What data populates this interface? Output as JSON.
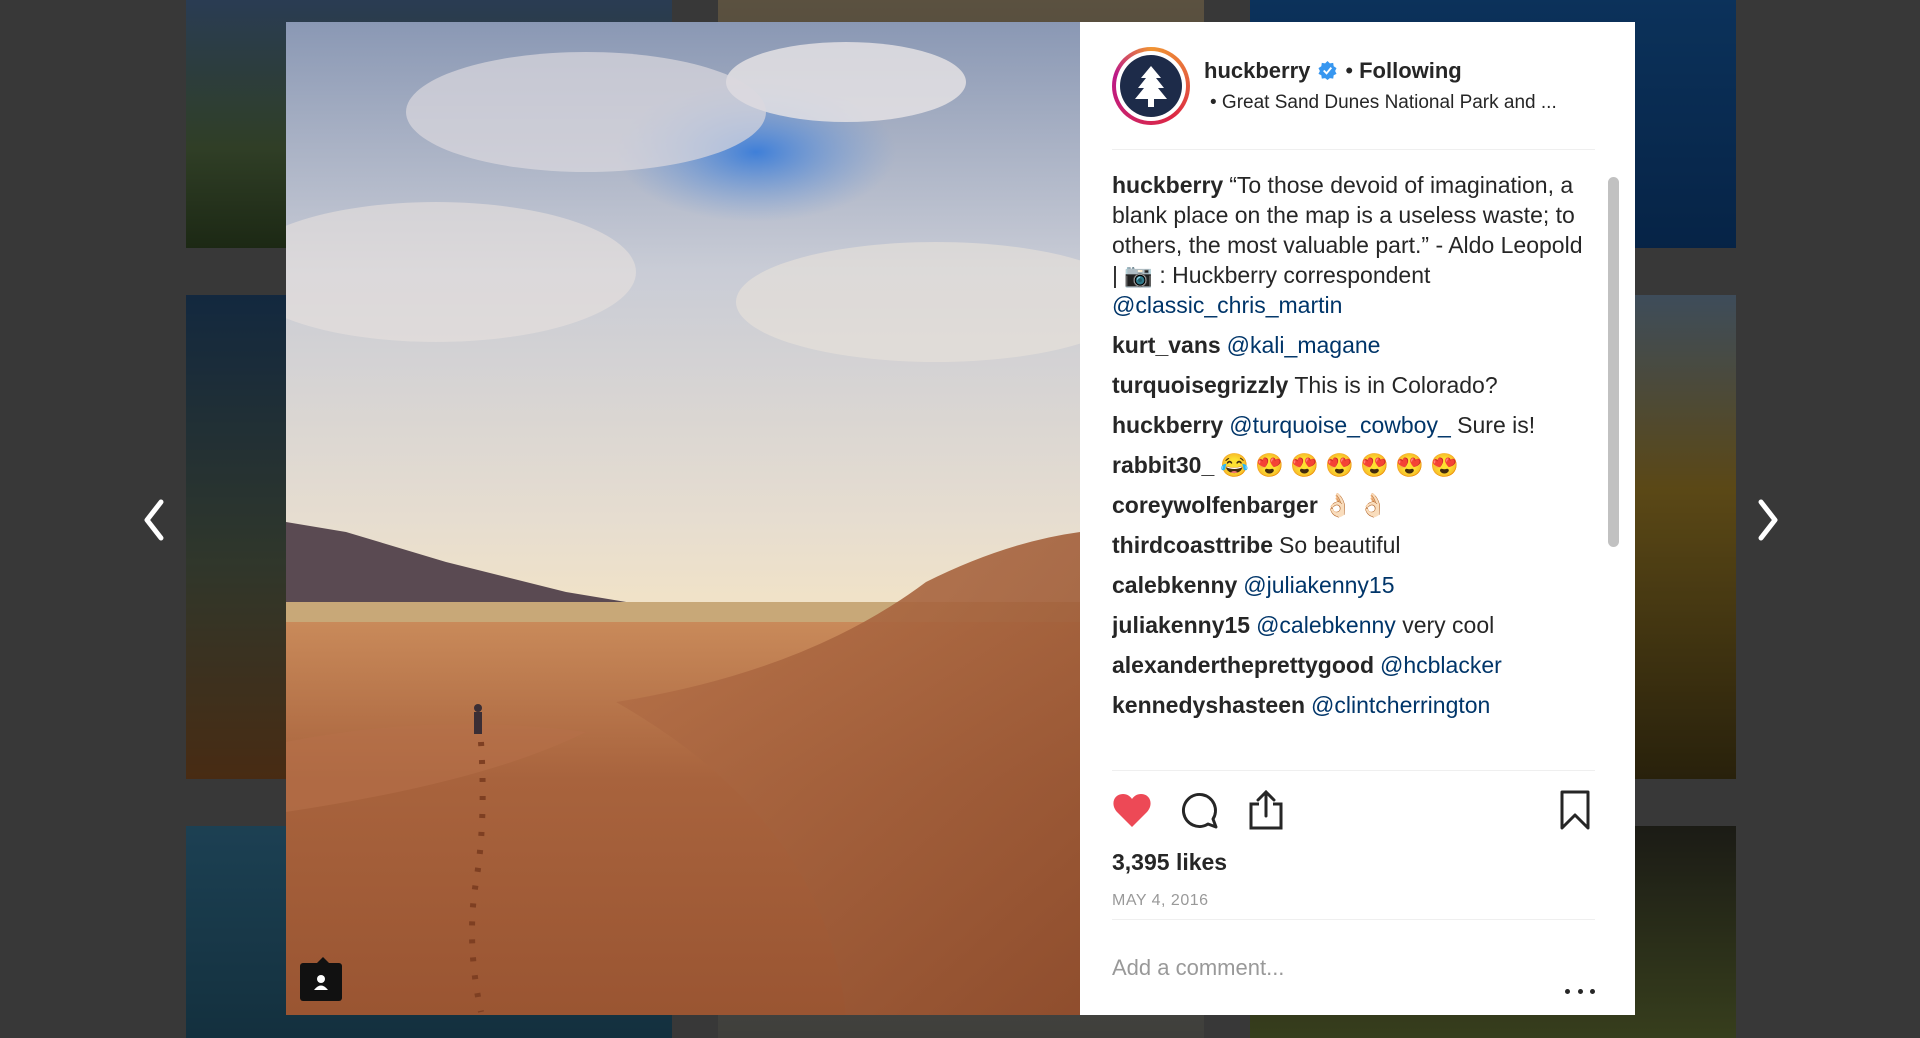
{
  "post": {
    "username": "huckberry",
    "dot": "•",
    "follow_status": "Following",
    "location": "• Great Sand Dunes National Park and ...",
    "caption": {
      "user": "huckberry",
      "line1": "“To those devoid of imagination, a blank place on the map is a useless waste; to others, the most valuable part.” - Aldo Leopold",
      "line2_prefix": "| 📷 : Huckberry correspondent",
      "mention": "@classic_chris_martin"
    },
    "comments": [
      {
        "user": "kurt_vans",
        "mention": "@kali_magane",
        "text": ""
      },
      {
        "user": "turquoisegrizzly",
        "mention": "",
        "text": "This is in Colorado?"
      },
      {
        "user": "huckberry",
        "mention": "@turquoise_cowboy_",
        "text": "Sure is!"
      },
      {
        "user": "rabbit30_",
        "mention": "",
        "text": "😂 😍 😍 😍 😍 😍 😍"
      },
      {
        "user": "coreywolfenbarger",
        "mention": "",
        "text": "👌🏻 👌🏻"
      },
      {
        "user": "thirdcoasttribe",
        "mention": "",
        "text": "So beautiful"
      },
      {
        "user": "calebkenny",
        "mention": "@juliakenny15",
        "text": ""
      },
      {
        "user": "juliakenny15",
        "mention": "@calebkenny",
        "text": "very cool"
      },
      {
        "user": "alexandertheprettygood",
        "mention": "@hcblacker",
        "text": ""
      },
      {
        "user": "kennedyshasteen",
        "mention": "@clintcherrington",
        "text": ""
      }
    ],
    "likes": "3,395 likes",
    "date": "MAY 4, 2016",
    "liked": true
  },
  "add_comment": {
    "placeholder": "Add a comment..."
  },
  "icons": {
    "like": "heart-icon",
    "comment": "comment-icon",
    "share": "share-icon",
    "save": "bookmark-icon",
    "more": "more-icon",
    "prev": "chevron-left-icon",
    "next": "chevron-right-icon",
    "tag": "user-tag-icon",
    "verified": "verified-badge-icon"
  },
  "colors": {
    "heart": "#ed4956",
    "mention": "#003569",
    "avatar_bg": "#1d2b49",
    "verified": "#3897f0"
  }
}
